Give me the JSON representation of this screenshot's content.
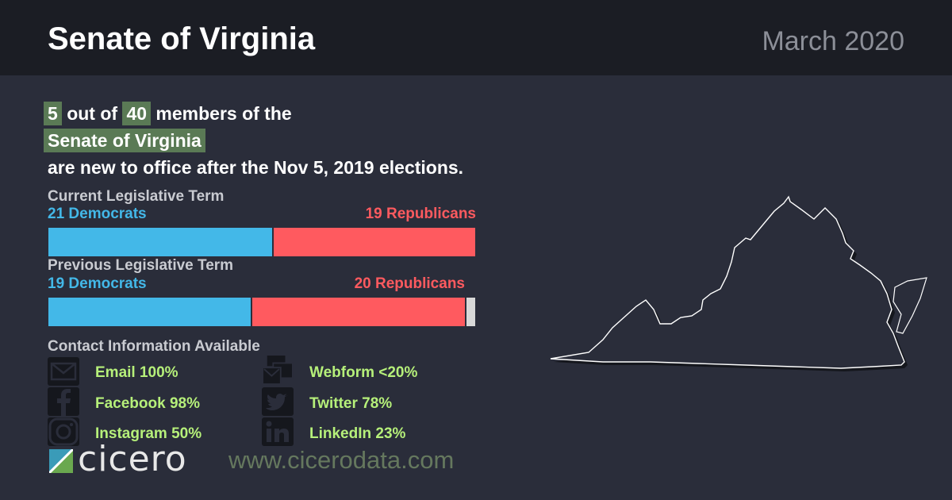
{
  "header": {
    "title": "Senate of Virginia",
    "date": "March 2020"
  },
  "headline": {
    "new_count": "5",
    "out_of": "out of",
    "total": "40",
    "members_of_the": "members of the",
    "chamber": "Senate of Virginia",
    "suffix": "are new to office after the Nov 5, 2019 elections."
  },
  "current_term": {
    "label": "Current Legislative Term",
    "dem_label": "21 Democrats",
    "rep_label": "19 Republicans",
    "dem_seats": 21,
    "rep_seats": 19,
    "vacant_seats": 0,
    "total_seats": 40
  },
  "previous_term": {
    "label": "Previous Legislative Term",
    "dem_label": "19 Democrats",
    "rep_label": "20 Republicans",
    "dem_seats": 19,
    "rep_seats": 20,
    "vacant_seats": 1,
    "total_seats": 40
  },
  "contact": {
    "title": "Contact Information Available",
    "items": [
      {
        "icon": "email-icon",
        "label": "Email 100%"
      },
      {
        "icon": "webform-icon",
        "label": "Webform <20%"
      },
      {
        "icon": "facebook-icon",
        "label": "Facebook 98%"
      },
      {
        "icon": "twitter-icon",
        "label": "Twitter 78%"
      },
      {
        "icon": "instagram-icon",
        "label": "Instagram 50%"
      },
      {
        "icon": "linkedin-icon",
        "label": "LinkedIn 23%"
      }
    ]
  },
  "footer": {
    "logo_text": "cicero",
    "url": "www.cicerodata.com"
  },
  "colors": {
    "democrat": "#43b8e8",
    "republican": "#ff5a5f",
    "vacant": "#d8d8d8",
    "highlight": "#5a7a55",
    "contact": "#b6f07a"
  }
}
